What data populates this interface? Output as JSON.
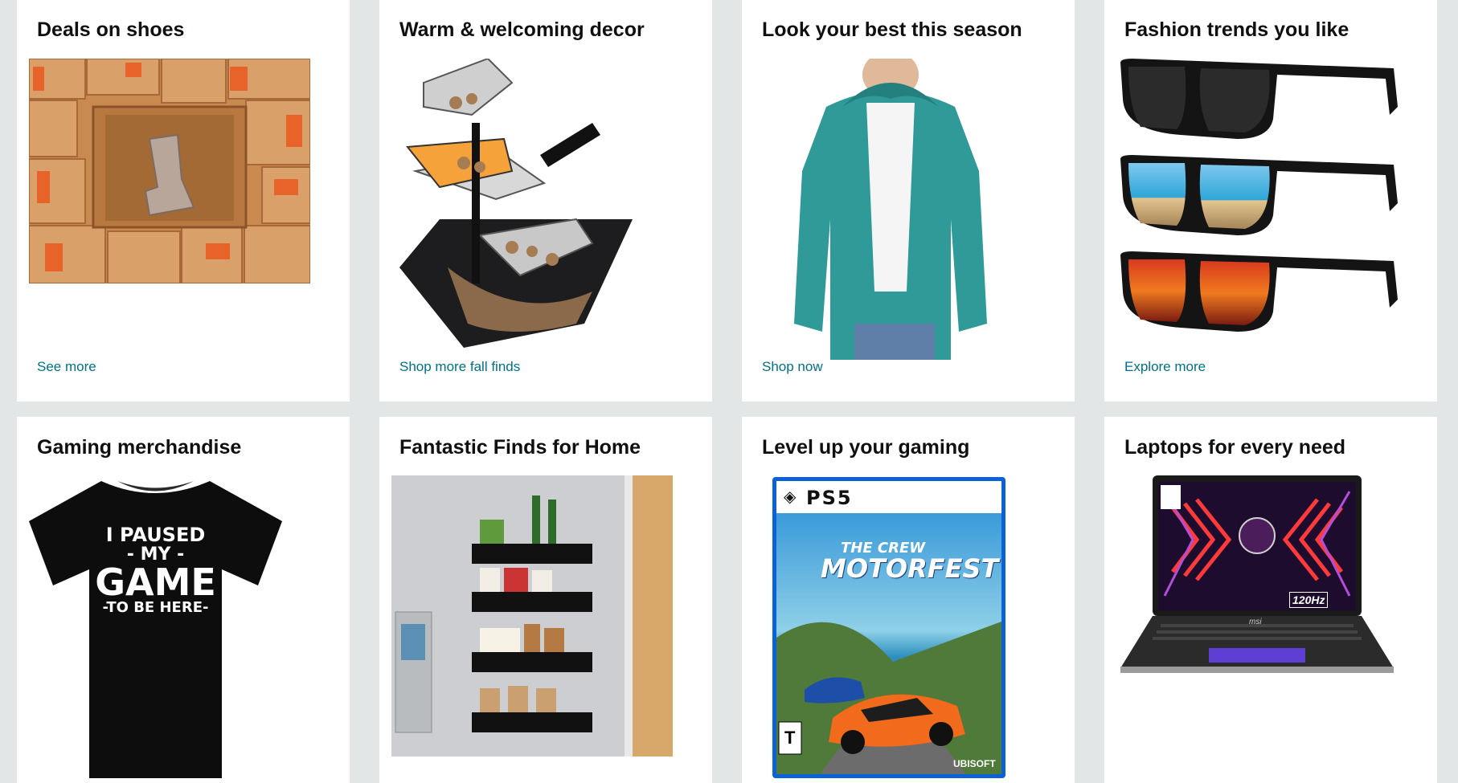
{
  "cards": [
    {
      "title": "Deals on shoes",
      "link": "See more",
      "image_icon": "shoe-boxes-image"
    },
    {
      "title": "Warm & welcoming decor",
      "link": "Shop more fall finds",
      "image_icon": "tabletop-fountain-image"
    },
    {
      "title": "Look your best this season",
      "link": "Shop now",
      "image_icon": "hoodie-image"
    },
    {
      "title": "Fashion trends you like",
      "link": "Explore more",
      "image_icon": "sunglasses-image"
    },
    {
      "title": "Gaming merchandise",
      "link": "",
      "image_icon": "tshirt-image",
      "shirt_lines": [
        "I PAUSED",
        "- MY -",
        "GAME",
        "-TO BE HERE-"
      ]
    },
    {
      "title": "Fantastic Finds for Home",
      "link": "",
      "image_icon": "fridge-rack-image"
    },
    {
      "title": "Level up your gaming",
      "link": "",
      "image_icon": "ps5-game-image",
      "game": {
        "platform": "PS5",
        "title_top": "THE CREW",
        "title_main": "MOTORFEST",
        "publisher": "UBISOFT",
        "rating": "T"
      }
    },
    {
      "title": "Laptops for every need",
      "link": "",
      "image_icon": "laptop-image",
      "laptop": {
        "refresh": "120Hz",
        "brand": "msi"
      }
    }
  ]
}
